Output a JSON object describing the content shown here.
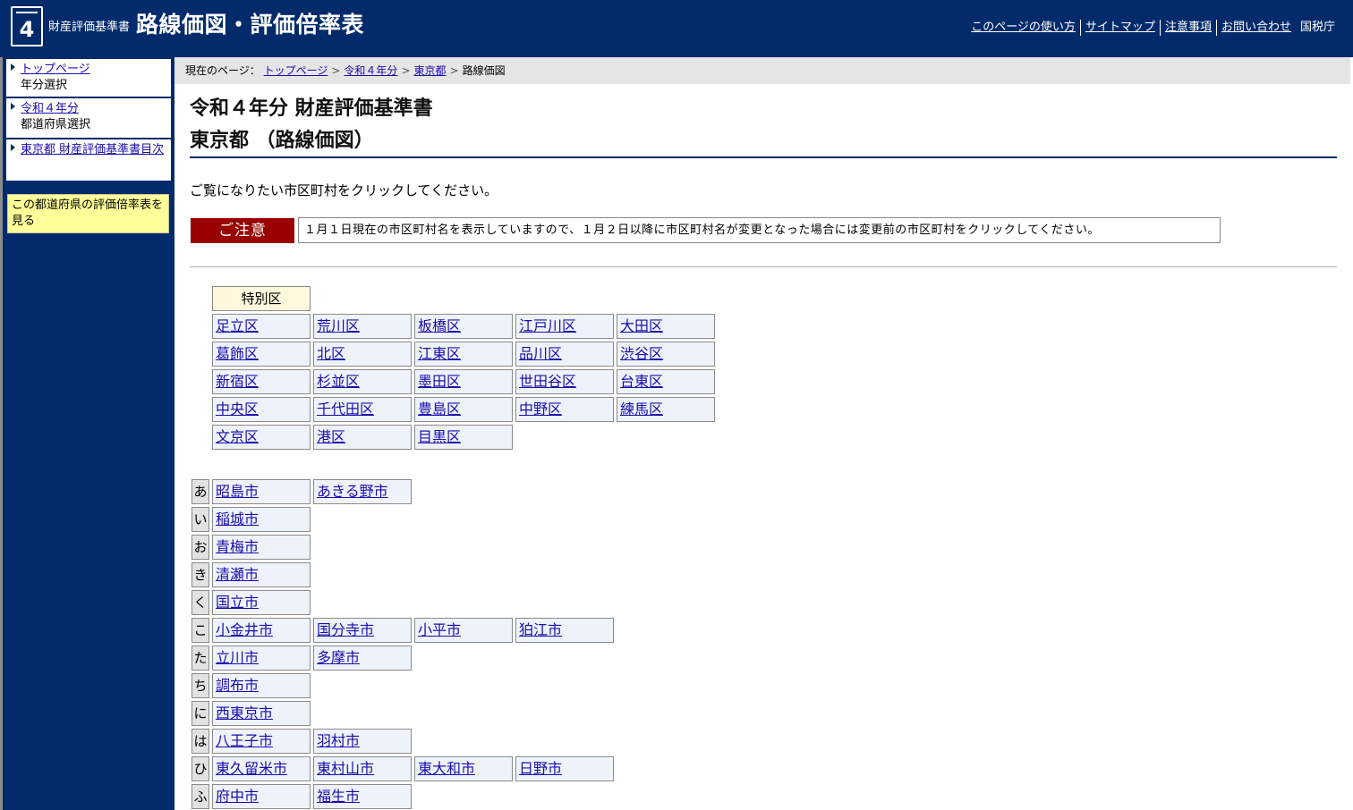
{
  "header": {
    "logo_number": "4",
    "site_sub": "財産評価基準書",
    "site_main": "路線価図・評価倍率表",
    "nav": [
      "このページの使い方",
      "サイトマップ",
      "注意事項",
      "お問い合わせ"
    ],
    "org": "国税庁"
  },
  "sidebar": {
    "items": [
      {
        "link": "トップページ",
        "sub": "年分選択"
      },
      {
        "link": "令和４年分",
        "sub": "都道府県選択"
      },
      {
        "link": "東京都 財産評価基準書目次",
        "sub": ""
      }
    ],
    "yellow_link": "この都道府県の評価倍率表を見る"
  },
  "breadcrumb": {
    "prefix": "現在のページ：",
    "links": [
      "トップページ",
      "令和４年分",
      "東京都"
    ],
    "current": "路線価図"
  },
  "main": {
    "title_line1": "令和４年分 財産評価基準書",
    "title_line2": "東京都 （路線価図）",
    "instruction": "ご覧になりたい市区町村をクリックしてください。",
    "notice_label": "ご注意",
    "notice_text": "１月１日現在の市区町村名を表示していますので、１月２日以降に市区町村名が変更となった場合には変更前の市区町村をクリックしてください。"
  },
  "wards": {
    "header": "特別区",
    "rows": [
      [
        "足立区",
        "荒川区",
        "板橋区",
        "江戸川区",
        "大田区"
      ],
      [
        "葛飾区",
        "北区",
        "江東区",
        "品川区",
        "渋谷区"
      ],
      [
        "新宿区",
        "杉並区",
        "墨田区",
        "世田谷区",
        "台東区"
      ],
      [
        "中央区",
        "千代田区",
        "豊島区",
        "中野区",
        "練馬区"
      ],
      [
        "文京区",
        "港区",
        "目黒区"
      ]
    ]
  },
  "cities": {
    "rows": [
      {
        "kana": "あ",
        "items": [
          "昭島市",
          "あきる野市"
        ]
      },
      {
        "kana": "い",
        "items": [
          "稲城市"
        ]
      },
      {
        "kana": "お",
        "items": [
          "青梅市"
        ]
      },
      {
        "kana": "き",
        "items": [
          "清瀬市"
        ]
      },
      {
        "kana": "く",
        "items": [
          "国立市"
        ]
      },
      {
        "kana": "こ",
        "items": [
          "小金井市",
          "国分寺市",
          "小平市",
          "狛江市"
        ]
      },
      {
        "kana": "た",
        "items": [
          "立川市",
          "多摩市"
        ]
      },
      {
        "kana": "ち",
        "items": [
          "調布市"
        ]
      },
      {
        "kana": "に",
        "items": [
          "西東京市"
        ]
      },
      {
        "kana": "は",
        "items": [
          "八王子市",
          "羽村市"
        ]
      },
      {
        "kana": "ひ",
        "items": [
          "東久留米市",
          "東村山市",
          "東大和市",
          "日野市"
        ]
      },
      {
        "kana": "ふ",
        "items": [
          "府中市",
          "福生市"
        ]
      }
    ]
  }
}
